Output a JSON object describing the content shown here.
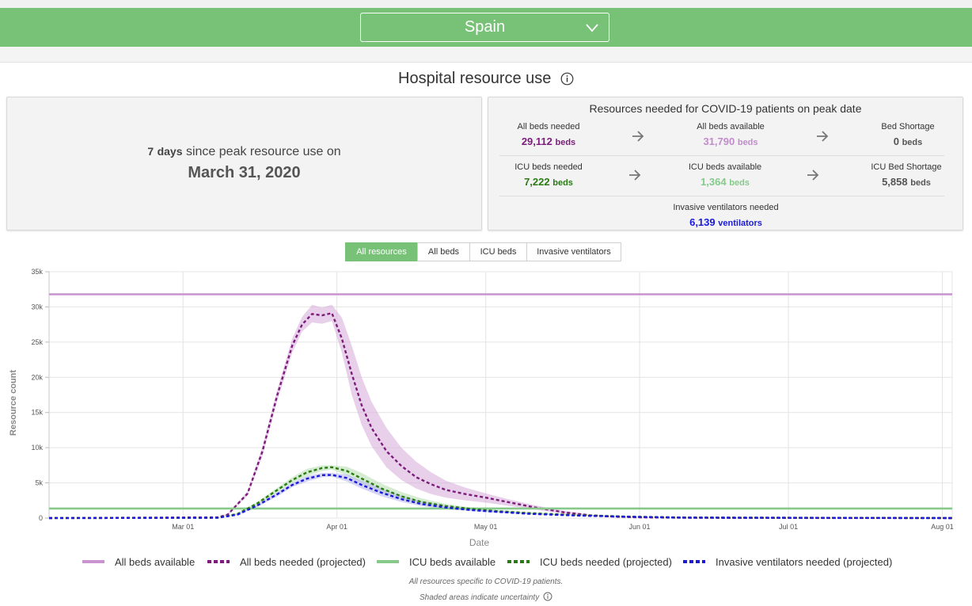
{
  "header": {
    "country": "Spain"
  },
  "page_title": "Hospital resource use",
  "peak": {
    "days": "7",
    "days_unit": "days",
    "since_text": "since peak resource use on",
    "date": "March 31, 2020"
  },
  "resources": {
    "title": "Resources needed for COVID-19 patients on peak date",
    "all_beds_needed": {
      "label": "All beds needed",
      "value": "29,112",
      "unit": "beds",
      "color": "#7b1c7b"
    },
    "all_beds_available": {
      "label": "All beds available",
      "value": "31,790",
      "unit": "beds",
      "color": "#c08ccc"
    },
    "bed_shortage": {
      "label": "Bed Shortage",
      "value": "0",
      "unit": "beds",
      "color": "#555555"
    },
    "icu_beds_needed": {
      "label": "ICU beds needed",
      "value": "7,222",
      "unit": "beds",
      "color": "#2a7a14"
    },
    "icu_beds_available": {
      "label": "ICU beds available",
      "value": "1,364",
      "unit": "beds",
      "color": "#86c98a"
    },
    "icu_bed_shortage": {
      "label": "ICU Bed Shortage",
      "value": "5,858",
      "unit": "beds",
      "color": "#555555"
    },
    "ventilators_needed": {
      "label": "Invasive ventilators needed",
      "value": "6,139",
      "unit": "ventilators",
      "color": "#1a1ad6"
    }
  },
  "tabs": [
    {
      "label": "All resources",
      "active": true
    },
    {
      "label": "All beds",
      "active": false
    },
    {
      "label": "ICU beds",
      "active": false
    },
    {
      "label": "Invasive ventilators",
      "active": false
    }
  ],
  "chart_data": {
    "type": "line",
    "xlabel": "Date",
    "ylabel": "Resource count",
    "xlim": [
      "2020-02-03",
      "2020-08-03"
    ],
    "ylim": [
      0,
      35000
    ],
    "y_ticks": [
      0,
      5000,
      10000,
      15000,
      20000,
      25000,
      30000,
      35000
    ],
    "y_tick_labels": [
      "0",
      "5k",
      "10k",
      "15k",
      "20k",
      "25k",
      "30k",
      "35k"
    ],
    "x_ticks": [
      "2020-03-01",
      "2020-04-01",
      "2020-05-01",
      "2020-06-01",
      "2020-07-01",
      "2020-08-01"
    ],
    "x_tick_labels": [
      "Mar 01",
      "Apr 01",
      "May 01",
      "Jun 01",
      "Jul 01",
      "Aug 01"
    ],
    "grid": true,
    "legend_position": "bottom",
    "series": [
      {
        "name": "All beds available",
        "style": "solid",
        "color": "#c993cf",
        "x": [
          "2020-02-03",
          "2020-08-03"
        ],
        "y": [
          31790,
          31790
        ]
      },
      {
        "name": "All beds needed (projected)",
        "style": "dashed",
        "color": "#7b1c7b",
        "band_color": "#d9b0dc",
        "x": [
          "2020-02-03",
          "2020-03-08",
          "2020-03-10",
          "2020-03-14",
          "2020-03-17",
          "2020-03-20",
          "2020-03-23",
          "2020-03-25",
          "2020-03-27",
          "2020-03-29",
          "2020-03-31",
          "2020-04-02",
          "2020-04-04",
          "2020-04-06",
          "2020-04-08",
          "2020-04-11",
          "2020-04-14",
          "2020-04-17",
          "2020-04-20",
          "2020-04-23",
          "2020-04-27",
          "2020-05-01",
          "2020-05-06",
          "2020-05-11",
          "2020-05-17",
          "2020-05-22",
          "2020-05-27",
          "2020-06-01",
          "2020-06-10",
          "2020-06-20",
          "2020-08-03"
        ],
        "y": [
          0,
          100,
          500,
          3500,
          9500,
          17500,
          24500,
          27500,
          29000,
          28800,
          29112,
          25500,
          20500,
          16000,
          12800,
          9500,
          7400,
          5800,
          4800,
          4000,
          3400,
          2900,
          2200,
          1500,
          800,
          400,
          200,
          100,
          50,
          20,
          0
        ],
        "y_upper": [
          0,
          120,
          600,
          3800,
          10200,
          18300,
          25500,
          28600,
          30300,
          29900,
          30300,
          28500,
          24500,
          20000,
          16500,
          12800,
          10000,
          8000,
          6500,
          5300,
          4300,
          3500,
          2600,
          1800,
          1000,
          500,
          250,
          120,
          60,
          25,
          0
        ],
        "y_lower": [
          0,
          80,
          400,
          3200,
          8800,
          16700,
          23500,
          26500,
          27800,
          27600,
          28000,
          23500,
          17500,
          13200,
          10200,
          7200,
          5400,
          4200,
          3400,
          2900,
          2500,
          2200,
          1700,
          1200,
          600,
          300,
          150,
          80,
          40,
          15,
          0
        ]
      },
      {
        "name": "ICU beds available",
        "style": "solid",
        "color": "#86c98a",
        "x": [
          "2020-02-03",
          "2020-08-03"
        ],
        "y": [
          1364,
          1364
        ]
      },
      {
        "name": "ICU beds needed (projected)",
        "style": "dashed",
        "color": "#2a7a14",
        "band_color": "#b9dfb2",
        "x": [
          "2020-02-03",
          "2020-03-08",
          "2020-03-12",
          "2020-03-16",
          "2020-03-20",
          "2020-03-23",
          "2020-03-26",
          "2020-03-29",
          "2020-03-31",
          "2020-04-03",
          "2020-04-06",
          "2020-04-10",
          "2020-04-14",
          "2020-04-18",
          "2020-04-23",
          "2020-04-28",
          "2020-05-03",
          "2020-05-10",
          "2020-05-20",
          "2020-05-30",
          "2020-06-10",
          "2020-08-03"
        ],
        "y": [
          0,
          50,
          600,
          2100,
          4000,
          5400,
          6500,
          7100,
          7222,
          6700,
          5600,
          4200,
          3100,
          2300,
          1700,
          1300,
          1000,
          700,
          400,
          200,
          80,
          0
        ],
        "y_upper": [
          0,
          60,
          700,
          2300,
          4300,
          5800,
          7000,
          7500,
          7500,
          7300,
          6400,
          4900,
          3700,
          2800,
          2000,
          1500,
          1150,
          800,
          450,
          230,
          90,
          0
        ],
        "y_lower": [
          0,
          40,
          500,
          1900,
          3700,
          5000,
          6000,
          6700,
          6900,
          6100,
          4900,
          3600,
          2600,
          1900,
          1400,
          1100,
          850,
          600,
          350,
          170,
          70,
          0
        ]
      },
      {
        "name": "Invasive ventilators needed (projected)",
        "style": "dashed",
        "color": "#1a1ad6",
        "band_color": "#b8b8f0",
        "x": [
          "2020-02-03",
          "2020-03-08",
          "2020-03-12",
          "2020-03-16",
          "2020-03-20",
          "2020-03-23",
          "2020-03-26",
          "2020-03-29",
          "2020-03-31",
          "2020-04-03",
          "2020-04-06",
          "2020-04-10",
          "2020-04-14",
          "2020-04-18",
          "2020-04-23",
          "2020-04-28",
          "2020-05-03",
          "2020-05-10",
          "2020-05-20",
          "2020-05-30",
          "2020-06-10",
          "2020-08-03"
        ],
        "y": [
          0,
          40,
          500,
          1800,
          3400,
          4700,
          5600,
          6100,
          6139,
          5700,
          4700,
          3600,
          2700,
          2000,
          1500,
          1150,
          900,
          600,
          350,
          180,
          70,
          0
        ],
        "y_upper": [
          0,
          50,
          600,
          2000,
          3700,
          5000,
          6000,
          6400,
          6400,
          6200,
          5300,
          4200,
          3200,
          2400,
          1800,
          1350,
          1050,
          700,
          400,
          210,
          80,
          0
        ],
        "y_lower": [
          0,
          30,
          420,
          1600,
          3100,
          4400,
          5200,
          5800,
          5900,
          5200,
          4200,
          3100,
          2300,
          1700,
          1250,
          980,
          780,
          520,
          300,
          150,
          60,
          0
        ]
      }
    ]
  },
  "footnotes": {
    "line1": "All resources specific to COVID-19 patients.",
    "line2": "Shaded areas indicate uncertainty"
  }
}
